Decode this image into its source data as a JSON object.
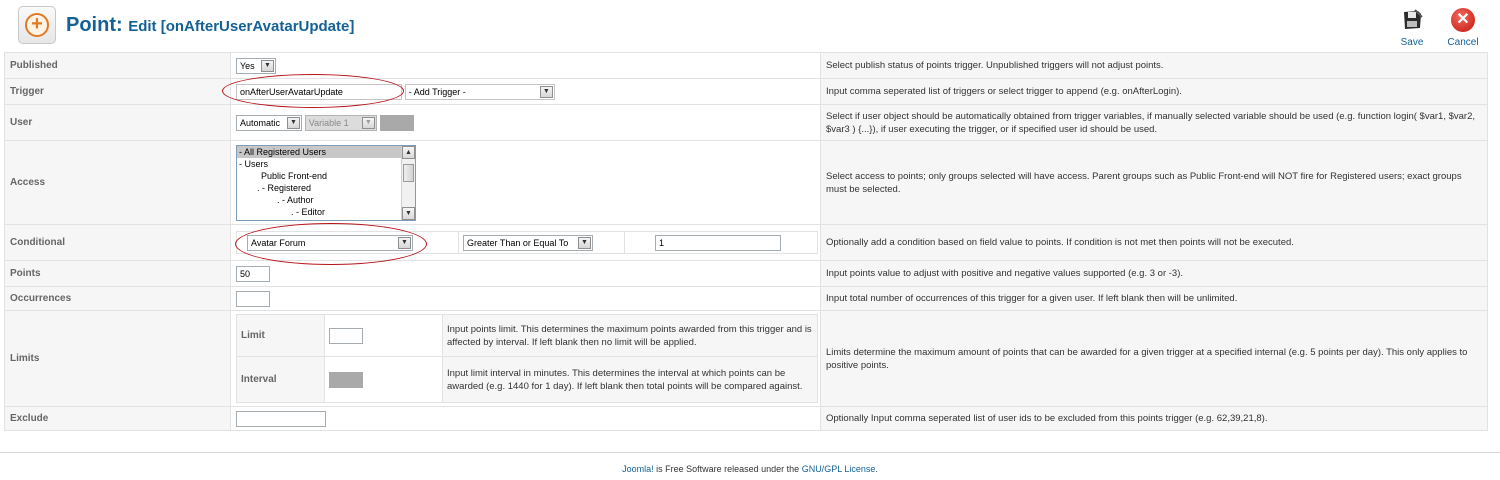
{
  "header": {
    "title": "Point:",
    "subtitle": "Edit [onAfterUserAvatarUpdate]",
    "icon": "add-circle-icon"
  },
  "toolbar": {
    "save_label": "Save",
    "cancel_label": "Cancel"
  },
  "form": {
    "published": {
      "label": "Published",
      "value": "Yes",
      "desc": "Select publish status of points trigger. Unpublished triggers will not adjust points."
    },
    "trigger": {
      "label": "Trigger",
      "value": "onAfterUserAvatarUpdate",
      "select_value": "- Add Trigger -",
      "desc": "Input comma seperated list of triggers or select trigger to append (e.g. onAfterLogin)."
    },
    "user": {
      "label": "User",
      "mode": "Automatic",
      "variable": "Variable 1",
      "desc": "Select if user object should be automatically obtained from trigger variables, if manually selected variable should be used (e.g. function login( $var1, $var2, $var3 ) {...}), if user executing the trigger, or if specified user id should be used."
    },
    "access": {
      "label": "Access",
      "options": [
        "- All Registered Users",
        "- Users",
        "Public Front-end",
        ". - Registered",
        ". - Author",
        ". - Editor"
      ],
      "desc": "Select access to points; only groups selected will have access. Parent groups such as Public Front-end will NOT fire for Registered users; exact groups must be selected."
    },
    "conditional": {
      "label": "Conditional",
      "field": "Avatar Forum",
      "operator": "Greater Than or Equal To",
      "value": "1",
      "desc": "Optionally add a condition based on field value to points. If condition is not met then points will not be executed."
    },
    "points": {
      "label": "Points",
      "value": "50",
      "desc": "Input points value to adjust with positive and negative values supported (e.g. 3 or -3)."
    },
    "occurrences": {
      "label": "Occurrences",
      "value": "",
      "desc": "Input total number of occurrences of this trigger for a given user. If left blank then will be unlimited."
    },
    "limits": {
      "label": "Limits",
      "limit_label": "Limit",
      "limit_value": "",
      "limit_desc": "Input points limit. This determines the maximum points awarded from this trigger and is affected by interval. If left blank then no limit will be applied.",
      "interval_label": "Interval",
      "interval_desc": "Input limit interval in minutes. This determines the interval at which points can be awarded (e.g. 1440 for 1 day). If left blank then total points will be compared against.",
      "desc": "Limits determine the maximum amount of points that can be awarded for a given trigger at a specified internal (e.g. 5 points per day). This only applies to positive points."
    },
    "exclude": {
      "label": "Exclude",
      "value": "",
      "desc": "Optionally Input comma seperated list of user ids to be excluded from this points trigger (e.g. 62,39,21,8)."
    }
  },
  "footer": {
    "brand": "Joomla!",
    "middle": " is Free Software released under the ",
    "license": "GNU/GPL License",
    "end": "."
  },
  "colors": {
    "title": "#146295",
    "annotation": "#b8141b",
    "key_bg": "#f6f6f6"
  }
}
